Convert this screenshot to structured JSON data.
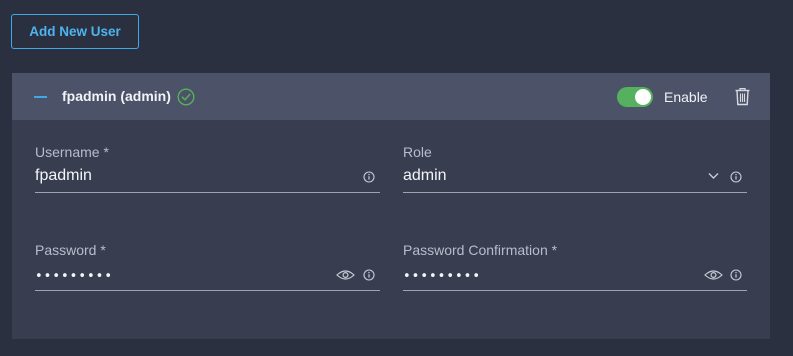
{
  "toolbar": {
    "add_user_label": "Add New User"
  },
  "user": {
    "title": "fpadmin (admin)",
    "enable_label": "Enable",
    "enabled": true
  },
  "form": {
    "username": {
      "label": "Username *",
      "value": "fpadmin"
    },
    "role": {
      "label": "Role",
      "value": "admin"
    },
    "password": {
      "label": "Password *",
      "value": "•••••••••"
    },
    "password_confirmation": {
      "label": "Password Confirmation *",
      "value": "•••••••••"
    }
  },
  "icons": {
    "collapse": "minus-icon",
    "status": "check-circle-icon",
    "delete": "trash-icon",
    "info": "info-icon",
    "reveal": "eye-icon",
    "dropdown": "chevron-down-icon"
  },
  "colors": {
    "background": "#2b3040",
    "card": "#383d50",
    "card_header": "#4c5267",
    "accent": "#3fa9e8",
    "success": "#55b15d"
  }
}
